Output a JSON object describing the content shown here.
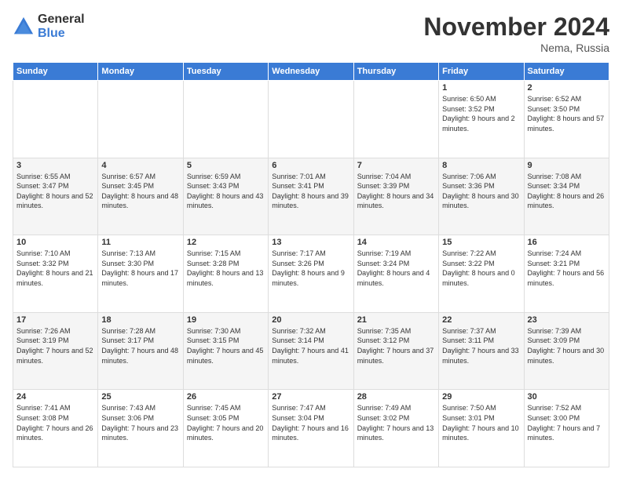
{
  "logo": {
    "general": "General",
    "blue": "Blue"
  },
  "title": "November 2024",
  "location": "Nema, Russia",
  "days_header": [
    "Sunday",
    "Monday",
    "Tuesday",
    "Wednesday",
    "Thursday",
    "Friday",
    "Saturday"
  ],
  "weeks": [
    [
      {
        "day": "",
        "sunrise": "",
        "sunset": "",
        "daylight": ""
      },
      {
        "day": "",
        "sunrise": "",
        "sunset": "",
        "daylight": ""
      },
      {
        "day": "",
        "sunrise": "",
        "sunset": "",
        "daylight": ""
      },
      {
        "day": "",
        "sunrise": "",
        "sunset": "",
        "daylight": ""
      },
      {
        "day": "",
        "sunrise": "",
        "sunset": "",
        "daylight": ""
      },
      {
        "day": "1",
        "sunrise": "Sunrise: 6:50 AM",
        "sunset": "Sunset: 3:52 PM",
        "daylight": "Daylight: 9 hours and 2 minutes."
      },
      {
        "day": "2",
        "sunrise": "Sunrise: 6:52 AM",
        "sunset": "Sunset: 3:50 PM",
        "daylight": "Daylight: 8 hours and 57 minutes."
      }
    ],
    [
      {
        "day": "3",
        "sunrise": "Sunrise: 6:55 AM",
        "sunset": "Sunset: 3:47 PM",
        "daylight": "Daylight: 8 hours and 52 minutes."
      },
      {
        "day": "4",
        "sunrise": "Sunrise: 6:57 AM",
        "sunset": "Sunset: 3:45 PM",
        "daylight": "Daylight: 8 hours and 48 minutes."
      },
      {
        "day": "5",
        "sunrise": "Sunrise: 6:59 AM",
        "sunset": "Sunset: 3:43 PM",
        "daylight": "Daylight: 8 hours and 43 minutes."
      },
      {
        "day": "6",
        "sunrise": "Sunrise: 7:01 AM",
        "sunset": "Sunset: 3:41 PM",
        "daylight": "Daylight: 8 hours and 39 minutes."
      },
      {
        "day": "7",
        "sunrise": "Sunrise: 7:04 AM",
        "sunset": "Sunset: 3:39 PM",
        "daylight": "Daylight: 8 hours and 34 minutes."
      },
      {
        "day": "8",
        "sunrise": "Sunrise: 7:06 AM",
        "sunset": "Sunset: 3:36 PM",
        "daylight": "Daylight: 8 hours and 30 minutes."
      },
      {
        "day": "9",
        "sunrise": "Sunrise: 7:08 AM",
        "sunset": "Sunset: 3:34 PM",
        "daylight": "Daylight: 8 hours and 26 minutes."
      }
    ],
    [
      {
        "day": "10",
        "sunrise": "Sunrise: 7:10 AM",
        "sunset": "Sunset: 3:32 PM",
        "daylight": "Daylight: 8 hours and 21 minutes."
      },
      {
        "day": "11",
        "sunrise": "Sunrise: 7:13 AM",
        "sunset": "Sunset: 3:30 PM",
        "daylight": "Daylight: 8 hours and 17 minutes."
      },
      {
        "day": "12",
        "sunrise": "Sunrise: 7:15 AM",
        "sunset": "Sunset: 3:28 PM",
        "daylight": "Daylight: 8 hours and 13 minutes."
      },
      {
        "day": "13",
        "sunrise": "Sunrise: 7:17 AM",
        "sunset": "Sunset: 3:26 PM",
        "daylight": "Daylight: 8 hours and 9 minutes."
      },
      {
        "day": "14",
        "sunrise": "Sunrise: 7:19 AM",
        "sunset": "Sunset: 3:24 PM",
        "daylight": "Daylight: 8 hours and 4 minutes."
      },
      {
        "day": "15",
        "sunrise": "Sunrise: 7:22 AM",
        "sunset": "Sunset: 3:22 PM",
        "daylight": "Daylight: 8 hours and 0 minutes."
      },
      {
        "day": "16",
        "sunrise": "Sunrise: 7:24 AM",
        "sunset": "Sunset: 3:21 PM",
        "daylight": "Daylight: 7 hours and 56 minutes."
      }
    ],
    [
      {
        "day": "17",
        "sunrise": "Sunrise: 7:26 AM",
        "sunset": "Sunset: 3:19 PM",
        "daylight": "Daylight: 7 hours and 52 minutes."
      },
      {
        "day": "18",
        "sunrise": "Sunrise: 7:28 AM",
        "sunset": "Sunset: 3:17 PM",
        "daylight": "Daylight: 7 hours and 48 minutes."
      },
      {
        "day": "19",
        "sunrise": "Sunrise: 7:30 AM",
        "sunset": "Sunset: 3:15 PM",
        "daylight": "Daylight: 7 hours and 45 minutes."
      },
      {
        "day": "20",
        "sunrise": "Sunrise: 7:32 AM",
        "sunset": "Sunset: 3:14 PM",
        "daylight": "Daylight: 7 hours and 41 minutes."
      },
      {
        "day": "21",
        "sunrise": "Sunrise: 7:35 AM",
        "sunset": "Sunset: 3:12 PM",
        "daylight": "Daylight: 7 hours and 37 minutes."
      },
      {
        "day": "22",
        "sunrise": "Sunrise: 7:37 AM",
        "sunset": "Sunset: 3:11 PM",
        "daylight": "Daylight: 7 hours and 33 minutes."
      },
      {
        "day": "23",
        "sunrise": "Sunrise: 7:39 AM",
        "sunset": "Sunset: 3:09 PM",
        "daylight": "Daylight: 7 hours and 30 minutes."
      }
    ],
    [
      {
        "day": "24",
        "sunrise": "Sunrise: 7:41 AM",
        "sunset": "Sunset: 3:08 PM",
        "daylight": "Daylight: 7 hours and 26 minutes."
      },
      {
        "day": "25",
        "sunrise": "Sunrise: 7:43 AM",
        "sunset": "Sunset: 3:06 PM",
        "daylight": "Daylight: 7 hours and 23 minutes."
      },
      {
        "day": "26",
        "sunrise": "Sunrise: 7:45 AM",
        "sunset": "Sunset: 3:05 PM",
        "daylight": "Daylight: 7 hours and 20 minutes."
      },
      {
        "day": "27",
        "sunrise": "Sunrise: 7:47 AM",
        "sunset": "Sunset: 3:04 PM",
        "daylight": "Daylight: 7 hours and 16 minutes."
      },
      {
        "day": "28",
        "sunrise": "Sunrise: 7:49 AM",
        "sunset": "Sunset: 3:02 PM",
        "daylight": "Daylight: 7 hours and 13 minutes."
      },
      {
        "day": "29",
        "sunrise": "Sunrise: 7:50 AM",
        "sunset": "Sunset: 3:01 PM",
        "daylight": "Daylight: 7 hours and 10 minutes."
      },
      {
        "day": "30",
        "sunrise": "Sunrise: 7:52 AM",
        "sunset": "Sunset: 3:00 PM",
        "daylight": "Daylight: 7 hours and 7 minutes."
      }
    ]
  ]
}
